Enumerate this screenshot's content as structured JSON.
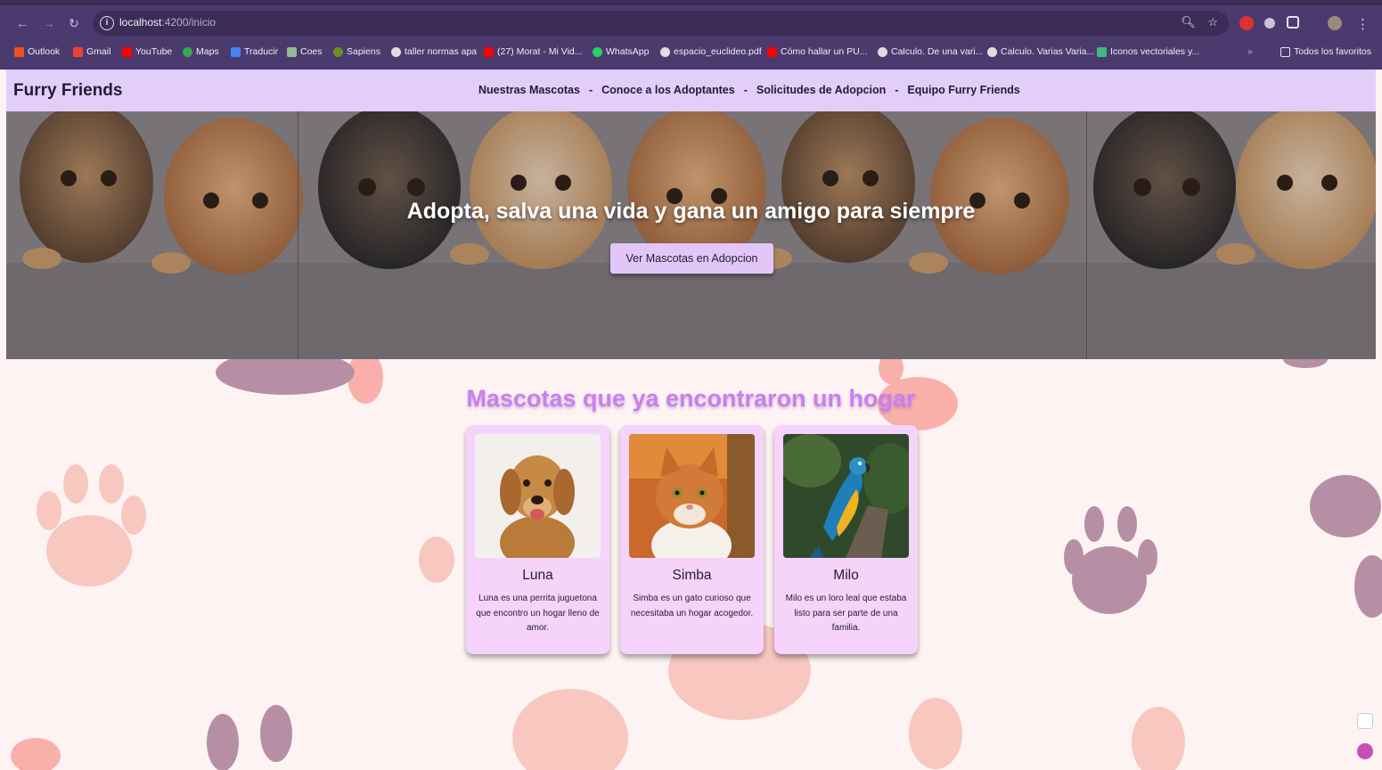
{
  "browser": {
    "url_host": "localhost",
    "url_path": ":4200/inicio",
    "back_icon": "arrow-left-icon",
    "forward_icon": "arrow-right-icon",
    "reload_icon": "reload-icon",
    "bookmarks": [
      {
        "label": "Outlook",
        "color": "#f25022"
      },
      {
        "label": "Gmail",
        "color": "#ea4335"
      },
      {
        "label": "YouTube",
        "color": "#ff0000"
      },
      {
        "label": "Maps",
        "color": "#34a853"
      },
      {
        "label": "Traducir",
        "color": "#4285f4"
      },
      {
        "label": "Coes",
        "color": "#8fbc8f"
      },
      {
        "label": "Sapiens",
        "color": "#6b8e23"
      },
      {
        "label": "taller normas apa",
        "color": "#dddddd"
      },
      {
        "label": "(27) Morat - Mi Vid...",
        "color": "#ff0000"
      },
      {
        "label": "WhatsApp",
        "color": "#25d366"
      },
      {
        "label": "espacio_euclideo.pdf",
        "color": "#dddddd"
      },
      {
        "label": "Cómo hallar un PU...",
        "color": "#ff0000"
      },
      {
        "label": "Calculo. De una vari...",
        "color": "#dddddd"
      },
      {
        "label": "Calculo. Varias Varia...",
        "color": "#dddddd"
      },
      {
        "label": "Iconos vectoriales y...",
        "color": "#41b883"
      }
    ],
    "more_bookmarks": "»",
    "all_favorites": "Todos los favoritos"
  },
  "navbar": {
    "brand": "Furry Friends",
    "links": [
      "Nuestras Mascotas",
      "Conoce a los Adoptantes",
      "Solicitudes de Adopcion",
      "Equipo Furry Friends"
    ],
    "separator": "-"
  },
  "hero": {
    "title": "Adopta, salva una vida y gana un amigo para siempre",
    "button": "Ver Mascotas en Adopcion"
  },
  "section": {
    "title": "Mascotas que ya encontraron un hogar"
  },
  "cards": [
    {
      "name": "Luna",
      "description": "Luna es una perrita juguetona que encontro un hogar lleno de amor.",
      "image": "golden-retriever-photo"
    },
    {
      "name": "Simba",
      "description": "Simba es un gato curioso que necesitaba un hogar acogedor.",
      "image": "orange-cat-photo"
    },
    {
      "name": "Milo",
      "description": "Milo es un loro leal que estaba listo para ser parte de una familia.",
      "image": "macaw-parrot-photo"
    }
  ],
  "colors": {
    "chrome": "#4b3a6e",
    "navbar": "#e3cdf9",
    "accent": "#c87ff0",
    "card": "#f5d3fb",
    "page_bg": "#fdf3f2"
  }
}
